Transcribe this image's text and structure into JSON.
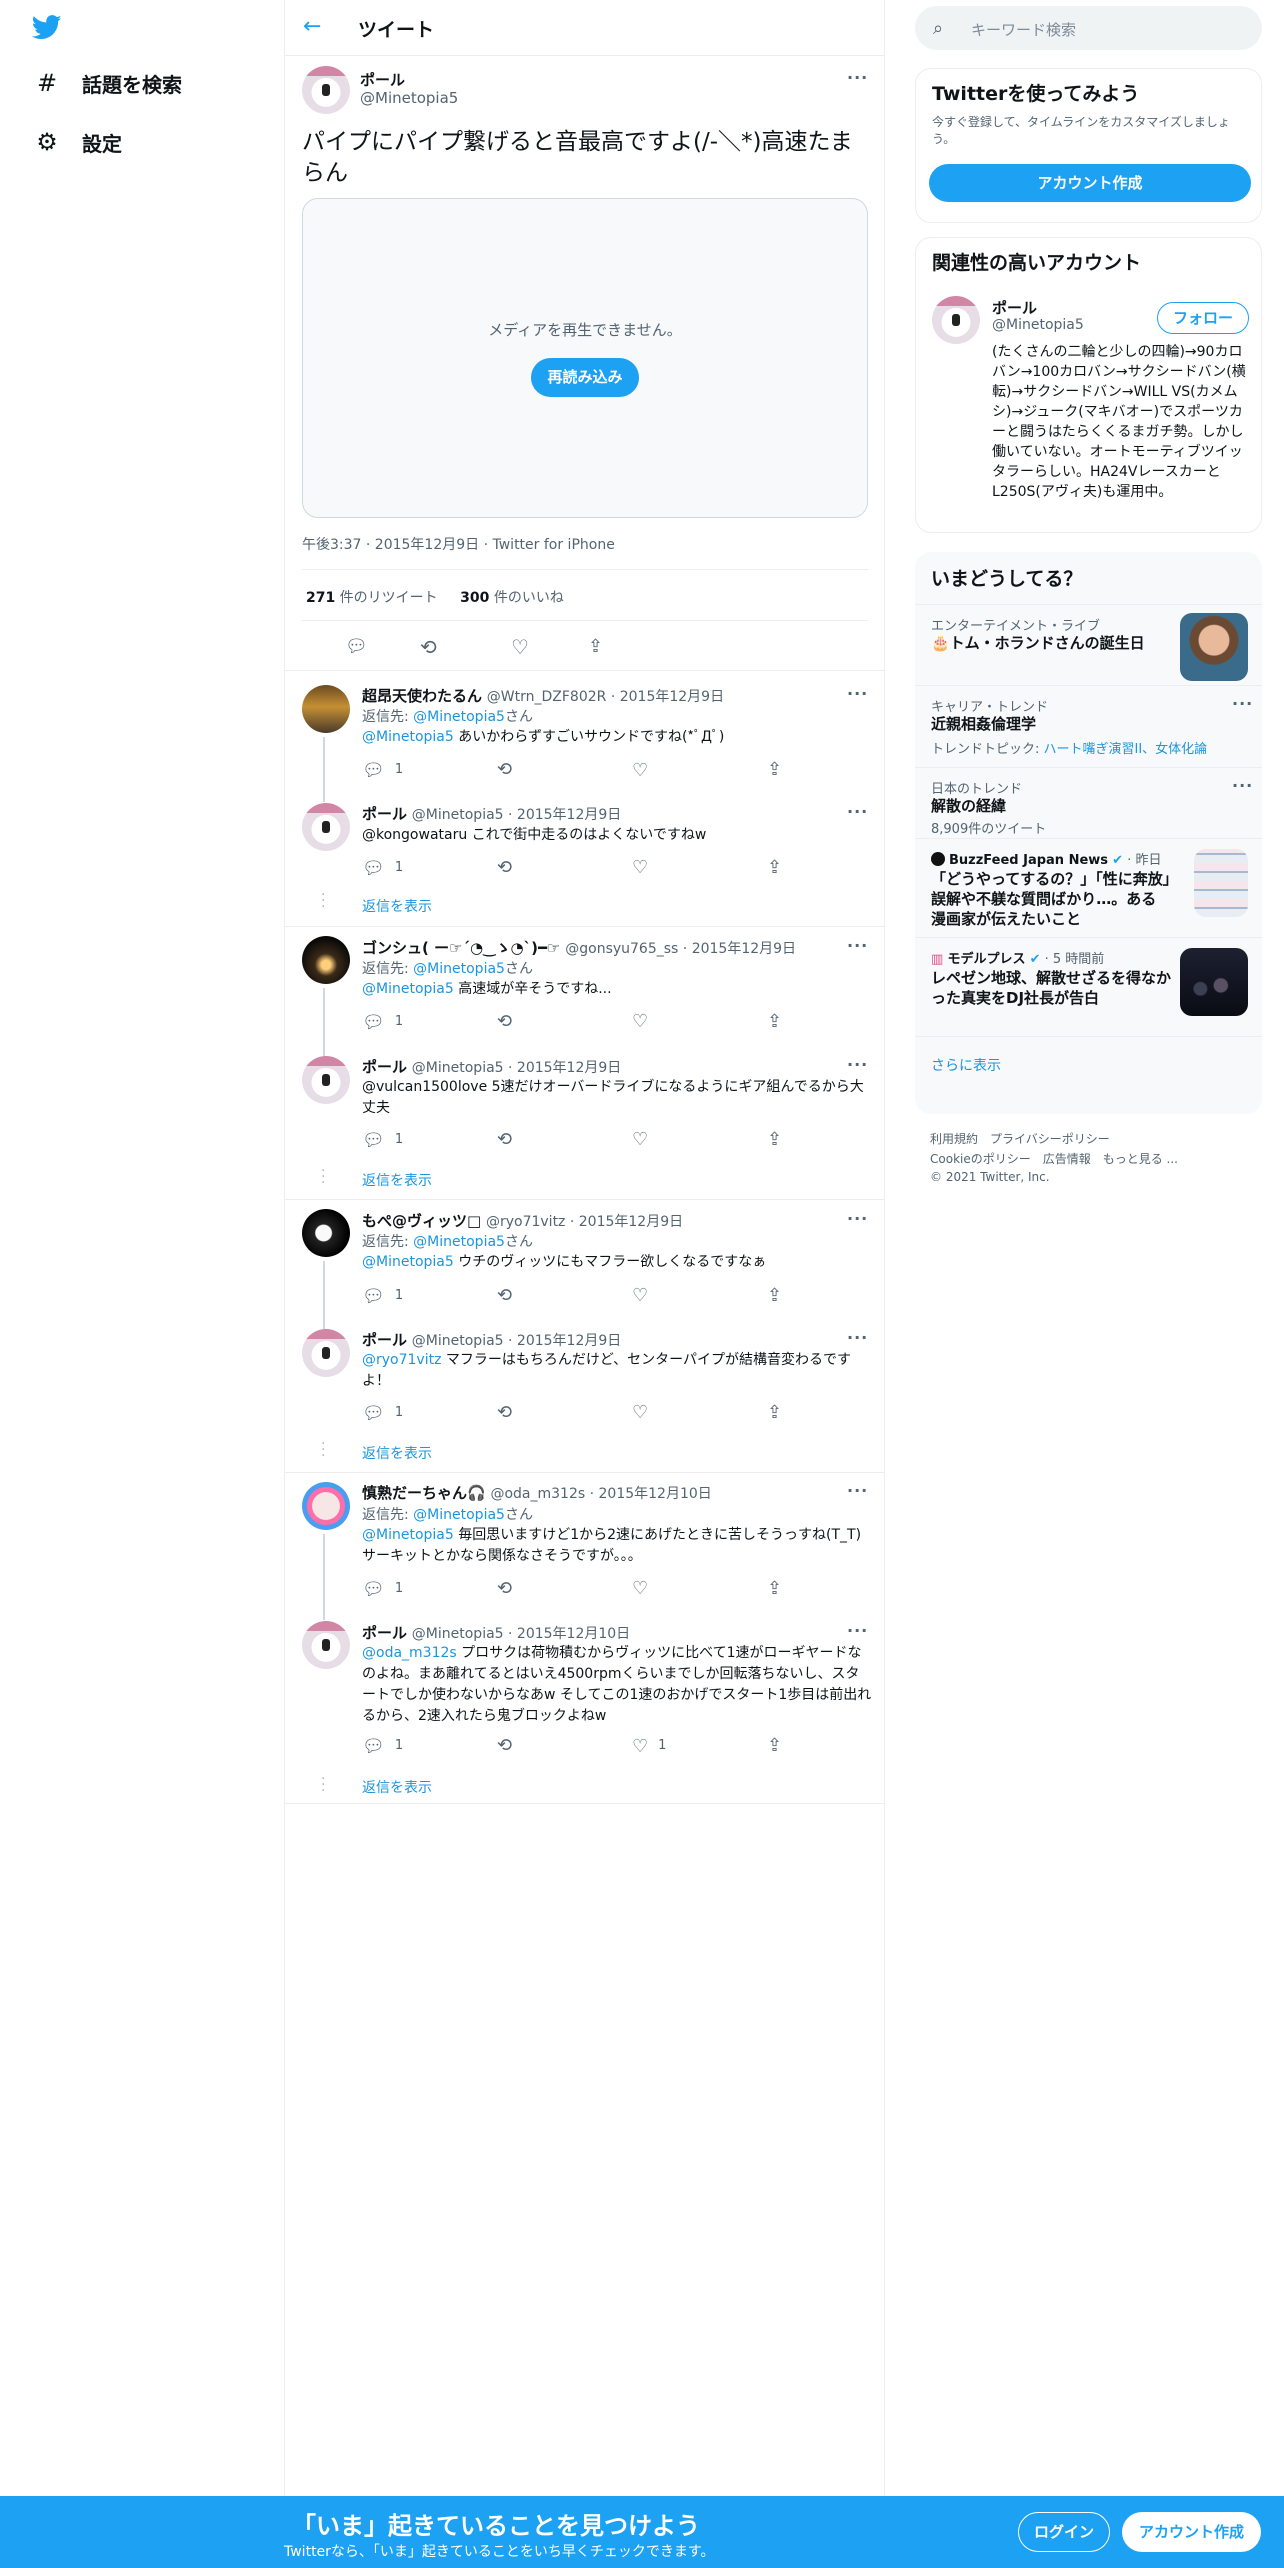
{
  "nav": {
    "explore": "話題を検索",
    "settings": "設定"
  },
  "header": {
    "title": "ツイート"
  },
  "tweet": {
    "name": "ポール",
    "handle": "@Minetopia5",
    "text": "パイプにパイプ繋げると音最高ですよ(/-＼*)高速たまらん",
    "media_message": "メディアを再生できません。",
    "reload_label": "再読み込み",
    "meta": "午後3:37 · 2015年12月9日 · Twitter for iPhone",
    "retweets": "271",
    "retweets_label": " 件のリツイート",
    "likes": "300",
    "likes_label": " 件のいいね"
  },
  "replies": [
    {
      "name": "超昂天使わたるん",
      "handle": "@Wtrn_DZF802R · 2015年12月9日",
      "replying": "返信先: ",
      "to": "@Minetopia5",
      "suffix": "さん",
      "mention": "@Minetopia5",
      "text": " あいかわらずすごいサウンドですね(*ﾟДﾟ)",
      "replies": "1",
      "likes": ""
    },
    {
      "name": "ポール",
      "handle": "@Minetopia5 · 2015年12月9日",
      "text": "@kongowataru これで街中走るのはよくないですねw",
      "replies": "1",
      "likes": ""
    },
    {
      "name": "ゴンシュ( ー☞´◔‿ゝ◔`)━☞",
      "handle": "@gonsyu765_ss · 2015年12月9日",
      "replying": "返信先: ",
      "to": "@Minetopia5",
      "suffix": "さん",
      "mention": "@Minetopia5",
      "text": " 高速域が辛そうですね...",
      "replies": "1",
      "likes": ""
    },
    {
      "name": "ポール",
      "handle": "@Minetopia5 · 2015年12月9日",
      "text": "@vulcan1500love 5速だけオーバードライブになるようにギア組んでるから大丈夫",
      "replies": "1",
      "likes": ""
    },
    {
      "name": "もぺ@ヴィッツ□",
      "handle": "@ryo71vitz · 2015年12月9日",
      "replying": "返信先: ",
      "to": "@Minetopia5",
      "suffix": "さん",
      "mention": "@Minetopia5",
      "text": " ウチのヴィッツにもマフラー欲しくなるですなぁ",
      "replies": "1",
      "likes": ""
    },
    {
      "name": "ポール",
      "handle": "@Minetopia5 · 2015年12月9日",
      "mention": "@ryo71vitz",
      "text": " マフラーはもちろんだけど、センターパイプが結構音変わるですよ！",
      "replies": "1",
      "likes": ""
    },
    {
      "name": "慎熟だーちゃん🎧",
      "handle": "@oda_m312s · 2015年12月10日",
      "replying": "返信先: ",
      "to": "@Minetopia5",
      "suffix": "さん",
      "mention": "@Minetopia5",
      "text": " 毎回思いますけど1から2速にあげたときに苦しそうっすね(T_T)サーキットとかなら関係なさそうですが。。。",
      "replies": "1",
      "likes": ""
    },
    {
      "name": "ポール",
      "handle": "@Minetopia5 · 2015年12月10日",
      "mention": "@oda_m312s",
      "text": " プロサクは荷物積むからヴィッツに比べて1速がローギヤードなのよね。まあ離れてるとはいえ4500rpmくらいまでしか回転落ちないし、スタートでしか使わないからなあw そしてこの1速のおかげでスタート1歩目は前出れるから、2速入れたら鬼ブロックよねw",
      "replies": "1",
      "likes": "1"
    }
  ],
  "show_replies": "返信を表示",
  "search": {
    "placeholder": "キーワード検索"
  },
  "signup_card": {
    "title": "Twitterを使ってみよう",
    "desc": "今すぐ登録して、タイムラインをカスタマイズしましょう。",
    "button": "アカウント作成"
  },
  "related": {
    "title": "関連性の高いアカウント",
    "name": "ポール",
    "handle": "@Minetopia5",
    "follow": "フォロー",
    "bio": "(たくさんの二輪と少しの四輪)→90カロバン→100カロバン→サクシードバン(横転)→サクシードバン→WILL VS(カメムシ)→ジューク(マキバオー)でスポーツカーと闘うはたらくくるまガチ勢。しかし働いていない。オートモーティブツイッタラーらしい。HA24VレースカーとL250S(アヴィ夫)も運用中。"
  },
  "trends": {
    "title": "いまどうしてる？",
    "items": [
      {
        "category": "エンターテイメント・ライブ",
        "title": "🎂トム・ホランドさんの誕生日"
      },
      {
        "category": "キャリア・トレンド",
        "title": "近親相姦倫理学",
        "topic_label": "トレンドトピック: ",
        "topic": "ハート嘴ぎ演習II、女体化論"
      },
      {
        "category": "日本のトレンド",
        "title": "解散の経緯",
        "count": "8,909件のツイート"
      },
      {
        "source": "BuzzFeed Japan News",
        "time": " · 昨日",
        "title": "「どうやってするの？」「性に奔放」誤解や不躾な質問ばかり…。ある漫画家が伝えたいこと"
      },
      {
        "source": "モデルプレス",
        "time": " · 5 時間前",
        "title": "レペゼン地球、解散せざるを得なかった真実をDJ社長が告白"
      }
    ],
    "more": "さらに表示"
  },
  "footer": {
    "line1": "利用規約　プライバシーポリシー",
    "line2": "Cookieのポリシー　広告情報　もっと見る ...",
    "line3": "© 2021 Twitter, Inc."
  },
  "banner": {
    "title": "「いま」起きていることを見つけよう",
    "subtitle": "Twitterなら、「いま」起きていることをいち早くチェックできます。",
    "login": "ログイン",
    "signup": "アカウント作成"
  },
  "colors": {
    "accent": "#1da1f2",
    "link": "#1b95e0"
  }
}
